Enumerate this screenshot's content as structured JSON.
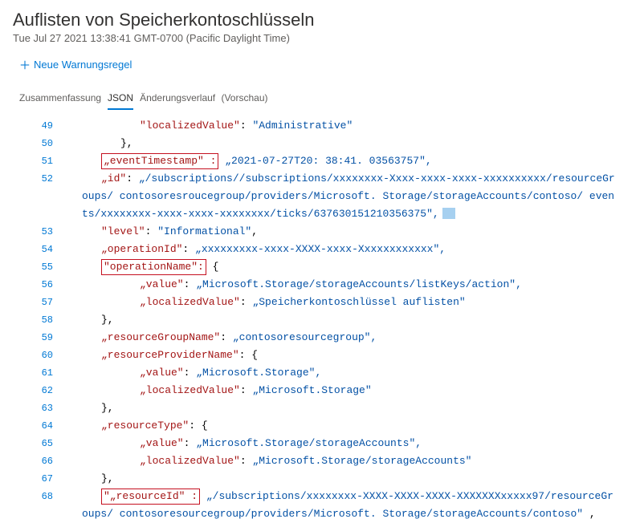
{
  "header": {
    "title": "Auflisten von Speicherkontoschlüsseln",
    "timestamp": "Tue Jul 27 2021 13:38:41 GMT-0700 (Pacific Daylight Time)"
  },
  "toolbar": {
    "new_alert_label": "Neue Warnungsregel"
  },
  "tabs": {
    "summary": "Zusammenfassung",
    "json": "JSON",
    "changes": "Änderungsverlauf",
    "preview": "(Vorschau)"
  },
  "json_view": {
    "lines": [
      {
        "no": 49,
        "indent": 3,
        "content": [
          {
            "t": "key",
            "v": "\"localizedValue\""
          },
          {
            "t": "punc",
            "v": ": "
          },
          {
            "t": "str",
            "v": "\"Administrative\""
          }
        ]
      },
      {
        "no": 50,
        "indent": 2,
        "content": [
          {
            "t": "punc",
            "v": "},"
          }
        ]
      },
      {
        "no": 51,
        "indent": 1,
        "content": [
          {
            "t": "box",
            "v": "„eventTimestamp\"   :"
          },
          {
            "t": "plain",
            "v": " "
          },
          {
            "t": "str",
            "v": "„2021-07-27T20: 38:41. 03563757\","
          }
        ]
      },
      {
        "no": 52,
        "indent": 1,
        "wrap": true,
        "content": [
          {
            "t": "key2",
            "v": "„id\""
          },
          {
            "t": "punc",
            "v": ": "
          },
          {
            "t": "str",
            "v": "„/subscriptions//subscriptions/xxxxxxxx-Xxxx-xxxx-xxxx-xxxxxxxxxx/resourceGroups/ contosoresroucegroup/providers/Microsoft.     Storage/storageAccounts/contoso/ events/xxxxxxxx-xxxx-xxxx-xxxxxxxx/ticks/637630151210356375\","
          }
        ],
        "trailing_hl": true
      },
      {
        "no": 53,
        "indent": 1,
        "content": [
          {
            "t": "key",
            "v": "\"level\""
          },
          {
            "t": "punc",
            "v": ": "
          },
          {
            "t": "str",
            "v": "\"Informational\""
          },
          {
            "t": "punc",
            "v": ","
          }
        ]
      },
      {
        "no": 54,
        "indent": 1,
        "content": [
          {
            "t": "key2",
            "v": "„operationId\""
          },
          {
            "t": "punc",
            "v": ": "
          },
          {
            "t": "str",
            "v": "„xxxxxxxxx-xxxx-XXXX-xxxx-Xxxxxxxxxxxx\","
          }
        ]
      },
      {
        "no": 55,
        "indent": 1,
        "content": [
          {
            "t": "box",
            "v": "\"operationName\":"
          },
          {
            "t": "plain",
            "v": " "
          },
          {
            "t": "punc",
            "v": "{"
          }
        ]
      },
      {
        "no": 56,
        "indent": 3,
        "content": [
          {
            "t": "key2",
            "v": "„value\""
          },
          {
            "t": "punc",
            "v": ":  "
          },
          {
            "t": "str",
            "v": "„Microsoft.Storage/storageAccounts/listKeys/action\","
          }
        ]
      },
      {
        "no": 57,
        "indent": 3,
        "content": [
          {
            "t": "key2",
            "v": "„localizedValue\""
          },
          {
            "t": "punc",
            "v": ": "
          },
          {
            "t": "str",
            "v": "„Speicherkontoschlüssel auflisten\""
          }
        ]
      },
      {
        "no": 58,
        "indent": 1,
        "content": [
          {
            "t": "punc",
            "v": "},"
          }
        ]
      },
      {
        "no": 59,
        "indent": 1,
        "content": [
          {
            "t": "key2",
            "v": "„resourceGroupName\""
          },
          {
            "t": "punc",
            "v": ": "
          },
          {
            "t": "str",
            "v": "„contosoresourcegroup\","
          }
        ]
      },
      {
        "no": 60,
        "indent": 1,
        "content": [
          {
            "t": "key2",
            "v": "„resourceProviderName\""
          },
          {
            "t": "punc",
            "v": ":    "
          },
          {
            "t": "punc",
            "v": "{"
          }
        ]
      },
      {
        "no": 61,
        "indent": 3,
        "content": [
          {
            "t": "key2",
            "v": "„value\""
          },
          {
            "t": "punc",
            "v": ": "
          },
          {
            "t": "str",
            "v": "„Microsoft.Storage\","
          }
        ]
      },
      {
        "no": 62,
        "indent": 3,
        "content": [
          {
            "t": "key2",
            "v": "„localizedValue\""
          },
          {
            "t": "punc",
            "v": ": "
          },
          {
            "t": "str",
            "v": "„Microsoft.Storage\""
          }
        ]
      },
      {
        "no": 63,
        "indent": 1,
        "content": [
          {
            "t": "punc",
            "v": "},"
          }
        ]
      },
      {
        "no": 64,
        "indent": 1,
        "content": [
          {
            "t": "key2",
            "v": "„resourceType\""
          },
          {
            "t": "punc",
            "v": ":   "
          },
          {
            "t": "punc",
            "v": "{"
          }
        ]
      },
      {
        "no": 65,
        "indent": 3,
        "content": [
          {
            "t": "key2",
            "v": "„value\""
          },
          {
            "t": "punc",
            "v": ": "
          },
          {
            "t": "str",
            "v": "„Microsoft.Storage/storageAccounts\","
          }
        ]
      },
      {
        "no": 66,
        "indent": 3,
        "content": [
          {
            "t": "key2",
            "v": "„localizedValue\""
          },
          {
            "t": "punc",
            "v": ": "
          },
          {
            "t": "str",
            "v": "„Microsoft.Storage/storageAccounts\""
          }
        ]
      },
      {
        "no": 67,
        "indent": 1,
        "content": [
          {
            "t": "punc",
            "v": "},"
          }
        ]
      },
      {
        "no": 68,
        "indent": 1,
        "wrap": true,
        "content": [
          {
            "t": "box",
            "v": "\"„resourceId\"  :"
          },
          {
            "t": "plain",
            "v": " "
          },
          {
            "t": "str",
            "v": "„/subscriptions/xxxxxxxx-XXXX-XXXX-XXXX-XXXXXXXxxxxx97/resourceGroups/ contosoresourcegroup/providers/Microsoft.      Storage/storageAccounts/contoso\""
          }
        ],
        "trailing_comma": true
      }
    ]
  }
}
